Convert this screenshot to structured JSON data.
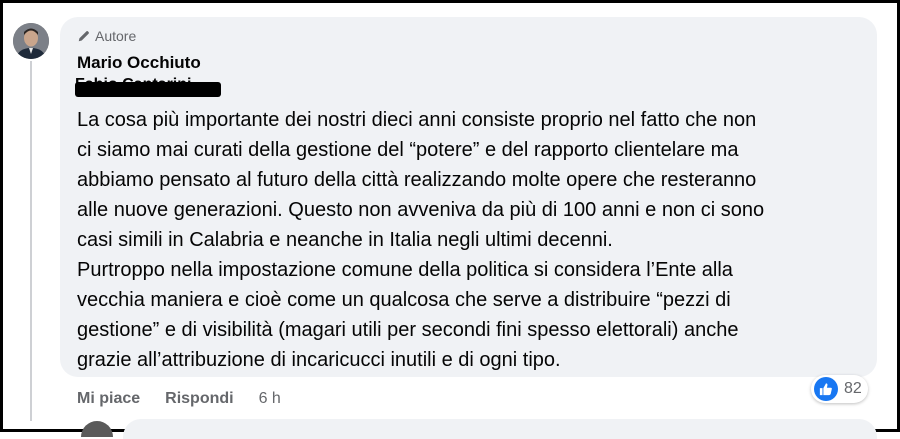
{
  "comment": {
    "author_badge": "Autore",
    "author_name": "Mario Occhiuto",
    "redacted_text": "Fabio Cantarini",
    "paragraph_1": "La cosa più importante dei nostri dieci anni consiste proprio nel fatto che non\nci siamo mai curati della gestione del “potere” e del rapporto clientelare ma\nabbiamo pensato al futuro della città realizzando molte opere che resteranno\nalle nuove generazioni. Questo non avveniva da più di 100 anni e non ci sono\ncasi simili in Calabria e neanche in Italia negli ultimi decenni.",
    "paragraph_2": "Purtroppo nella impostazione comune della politica si considera l’Ente alla\nvecchia maniera e cioè come un qualcosa che serve a distribuire “pezzi di\ngestione” e di visibilità (magari utili per secondi fini spesso elettorali) anche\ngrazie all’attribuzione di incaricucci inutili e di ogni tipo."
  },
  "actions": {
    "like_label": "Mi piace",
    "reply_label": "Rispondi",
    "timestamp": "6 h"
  },
  "reactions": {
    "count": "82",
    "icon": "like-icon",
    "color": "#1877f2"
  }
}
